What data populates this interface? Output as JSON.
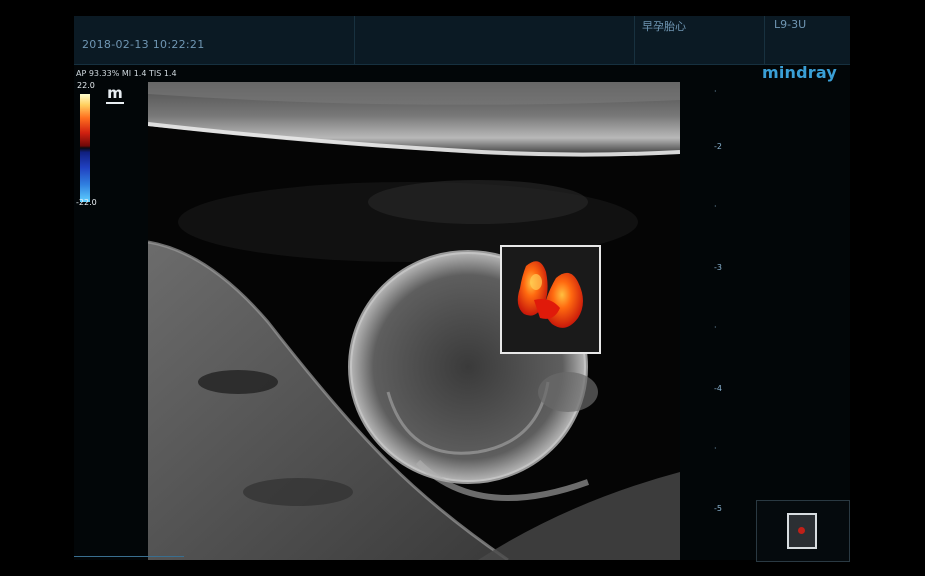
{
  "header": {
    "datetime": "2018-02-13    10:22:21",
    "preset": "早孕胎心",
    "probe": "L9-3U"
  },
  "brand": "mindray",
  "params": "AP 93.33%  MI 1.4 TIS 1.4",
  "color_scale": {
    "max": "22.0",
    "min": "-22.0"
  },
  "depth_ticks": [
    {
      "label": "-2",
      "value": 2
    },
    {
      "label": "-3",
      "value": 3
    },
    {
      "label": "-4",
      "value": 4
    },
    {
      "label": "-5",
      "value": 5
    }
  ],
  "icons": {
    "mode": "m-icon"
  },
  "colors": {
    "brand": "#3a9fd6",
    "header_bg": "#0b1a24",
    "header_text": "#6f96b3",
    "flow_red": "#e0200c",
    "flow_yellow": "#ff9a1a"
  }
}
